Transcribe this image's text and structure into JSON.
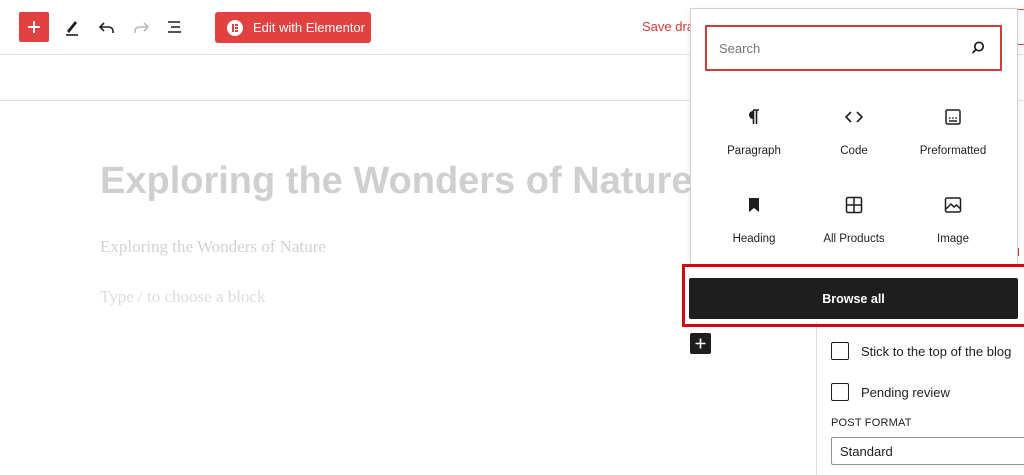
{
  "toolbar": {
    "elementor_label": "Edit with Elementor",
    "save_draft_label": "Save dra"
  },
  "editor": {
    "title": "Exploring the Wonders of Nature",
    "subtitle": "Exploring the Wonders of Nature",
    "block_placeholder": "Type / to choose a block"
  },
  "inserter": {
    "search_placeholder": "Search",
    "search_value": "",
    "blocks": [
      {
        "label": "Paragraph",
        "icon": "paragraph-icon"
      },
      {
        "label": "Code",
        "icon": "code-icon"
      },
      {
        "label": "Preformatted",
        "icon": "preformatted-icon"
      },
      {
        "label": "Heading",
        "icon": "bookmark-icon"
      },
      {
        "label": "All Products",
        "icon": "grid-icon"
      },
      {
        "label": "Image",
        "icon": "image-icon"
      }
    ],
    "browse_all_label": "Browse all"
  },
  "sidebar": {
    "stick_label": "Stick to the top of the blog",
    "pending_label": "Pending review",
    "post_format_label": "POST FORMAT",
    "post_format_value": "Standard"
  },
  "colors": {
    "accent": "#e2423f",
    "highlight_border": "#d10a12",
    "dark": "#1e1e1e"
  }
}
